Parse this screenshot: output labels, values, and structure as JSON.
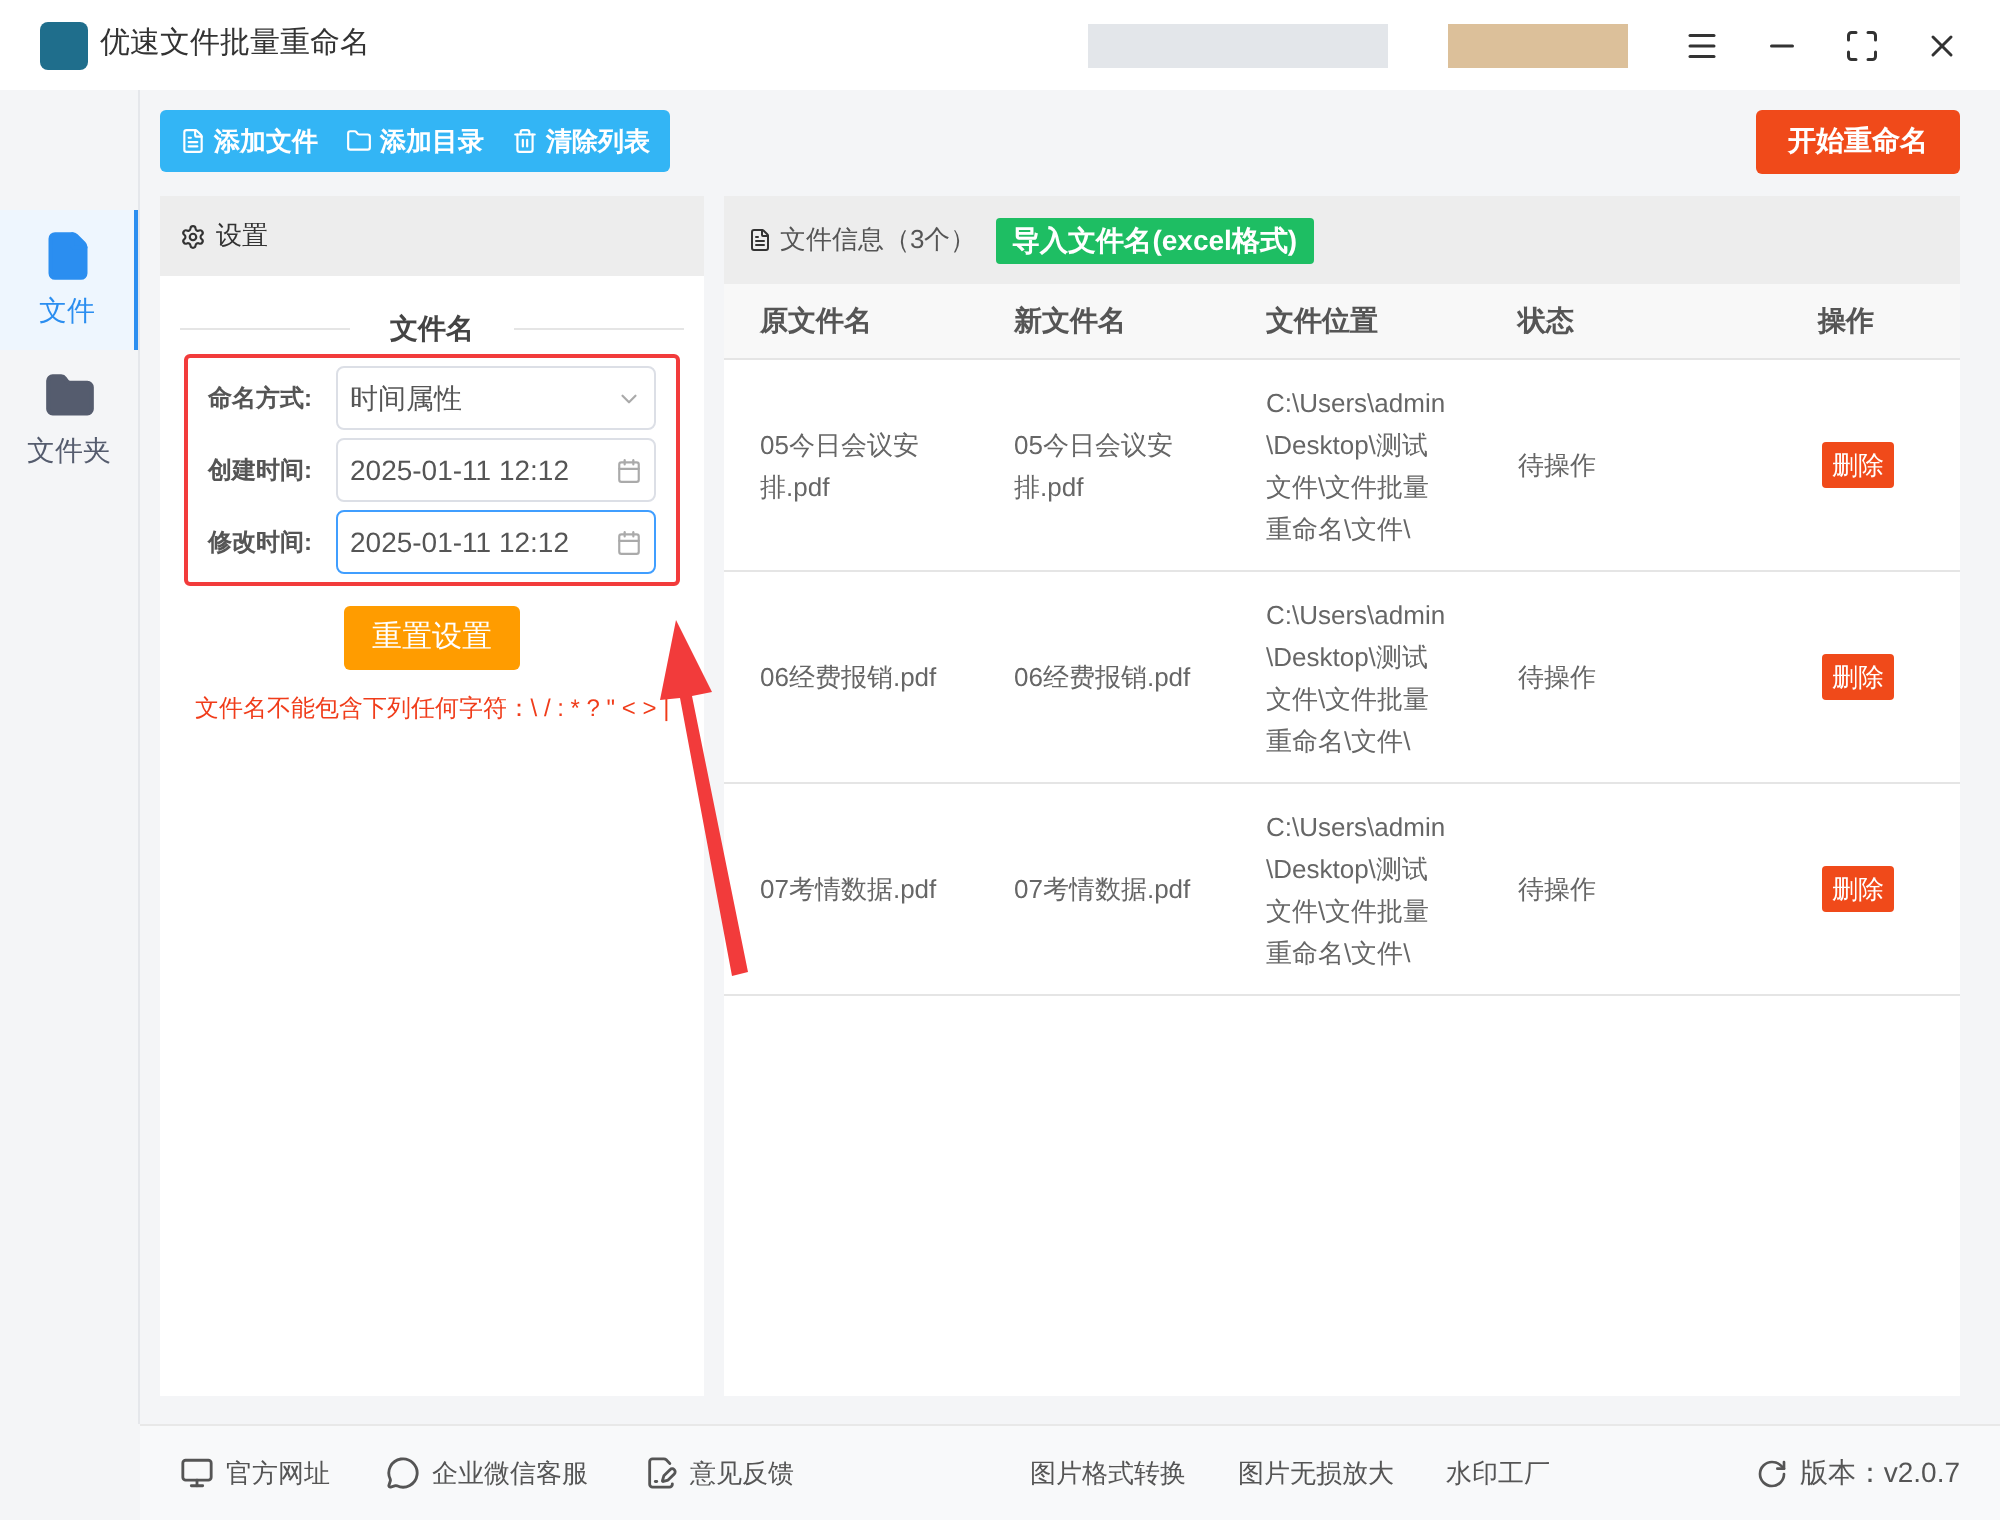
{
  "window": {
    "title": "优速文件批量重命名"
  },
  "toolbar": {
    "buttons": [
      {
        "kind": "file",
        "label": "添加文件"
      },
      {
        "kind": "folder",
        "label": "添加目录"
      },
      {
        "kind": "trash",
        "label": "清除列表"
      }
    ],
    "start_button": "开始重命名"
  },
  "sidebar": {
    "items": [
      {
        "kind": "file",
        "label": "文件",
        "selected": true
      },
      {
        "kind": "folder",
        "label": "文件夹",
        "selected": false
      }
    ]
  },
  "settings": {
    "title": "设置",
    "section": "文件名",
    "fields": [
      {
        "kind": "select",
        "label": "命名方式:",
        "value": "时间属性",
        "focused": false
      },
      {
        "kind": "date",
        "label": "创建时间:",
        "value": "2025-01-11 12:12",
        "focused": false
      },
      {
        "kind": "date",
        "label": "修改时间:",
        "value": "2025-01-11 12:12",
        "focused": true
      }
    ],
    "reset_button": "重置设置",
    "warning": "文件名不能包含下列任何字符：\\ / : * ? \" < > |"
  },
  "files": {
    "title": "文件信息（3个）",
    "import_button": "导入文件名(excel格式)",
    "columns": [
      "原文件名",
      "新文件名",
      "文件位置",
      "状态",
      "操作"
    ],
    "rows": [
      {
        "original": "05今日会议安排.pdf",
        "new": "05今日会议安排.pdf",
        "location": "C:\\Users\\admin\\Desktop\\测试文件\\文件批量重命名\\文件\\",
        "status": "待操作",
        "action": "删除"
      },
      {
        "original": "06经费报销.pdf",
        "new": "06经费报销.pdf",
        "location": "C:\\Users\\admin\\Desktop\\测试文件\\文件批量重命名\\文件\\",
        "status": "待操作",
        "action": "删除"
      },
      {
        "original": "07考情数据.pdf",
        "new": "07考情数据.pdf",
        "location": "C:\\Users\\admin\\Desktop\\测试文件\\文件批量重命名\\文件\\",
        "status": "待操作",
        "action": "删除"
      }
    ]
  },
  "footer": {
    "links": [
      {
        "kind": "web",
        "label": "官方网址"
      },
      {
        "kind": "chat",
        "label": "企业微信客服"
      },
      {
        "kind": "feedback",
        "label": "意见反馈"
      }
    ],
    "tools": [
      "图片格式转换",
      "图片无损放大",
      "水印工厂"
    ],
    "version": "版本：v2.0.7"
  }
}
